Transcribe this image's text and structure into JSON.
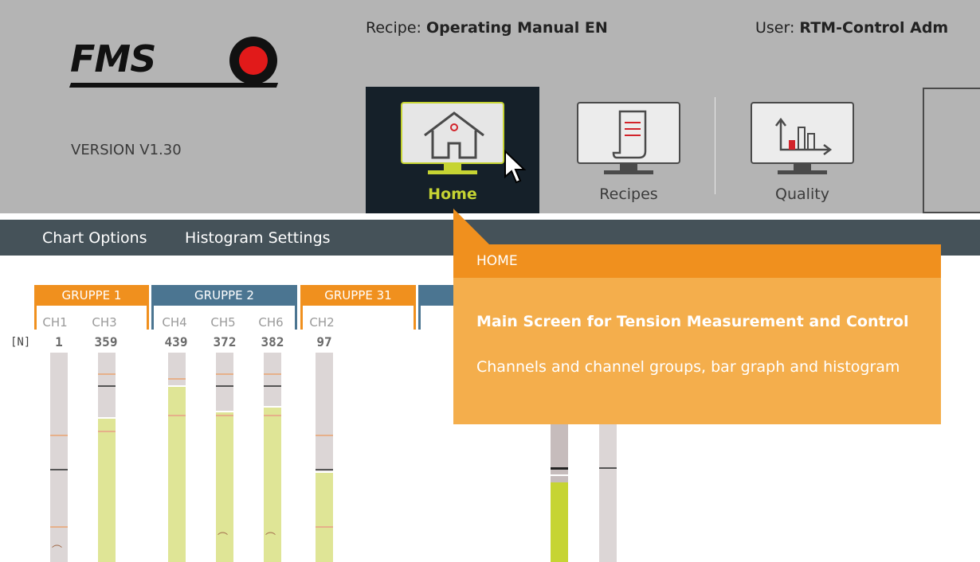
{
  "header": {
    "logo_text": "FMS",
    "version": "VERSION V1.30",
    "recipe_label": "Recipe:",
    "recipe_value": "Operating Manual EN",
    "user_label": "User:",
    "user_value": "RTM-Control Adm"
  },
  "nav": {
    "home": {
      "label": "Home",
      "icon": "home-icon",
      "active": true
    },
    "recipes": {
      "label": "Recipes",
      "icon": "recipe-document-icon"
    },
    "quality": {
      "label": "Quality",
      "icon": "quality-chart-icon"
    }
  },
  "menu": {
    "chart_options": "Chart Options",
    "histogram_settings": "Histogram Settings"
  },
  "groups": [
    {
      "name": "GRUPPE 1",
      "color": "#f0901e"
    },
    {
      "name": "GRUPPE 2",
      "color": "#4b7591"
    },
    {
      "name": "GRUPPE 31",
      "color": "#f0901e"
    },
    {
      "name": "",
      "color": "#4b7591"
    }
  ],
  "unit": "[N]",
  "channels": [
    {
      "name": "CH1",
      "value": "1",
      "fill_pct": 0
    },
    {
      "name": "CH3",
      "value": "359",
      "fill_pct": 69
    },
    {
      "name": "CH4",
      "value": "439",
      "fill_pct": 84
    },
    {
      "name": "CH5",
      "value": "372",
      "fill_pct": 72
    },
    {
      "name": "CH6",
      "value": "382",
      "fill_pct": 74
    },
    {
      "name": "CH2",
      "value": "97",
      "fill_pct": 43
    }
  ],
  "tooltip": {
    "title": "HOME",
    "heading": "Main Screen for Tension Measurement and Control",
    "description": "Channels and channel groups, bar graph and histogram"
  },
  "colors": {
    "header_bg": "#b4b4b4",
    "active_nav_bg": "#152029",
    "accent_green": "#c6d433",
    "menubar_bg": "#455259",
    "orange": "#f0901e",
    "tooltip_body": "#f4ae4c",
    "blue_group": "#4b7591"
  }
}
